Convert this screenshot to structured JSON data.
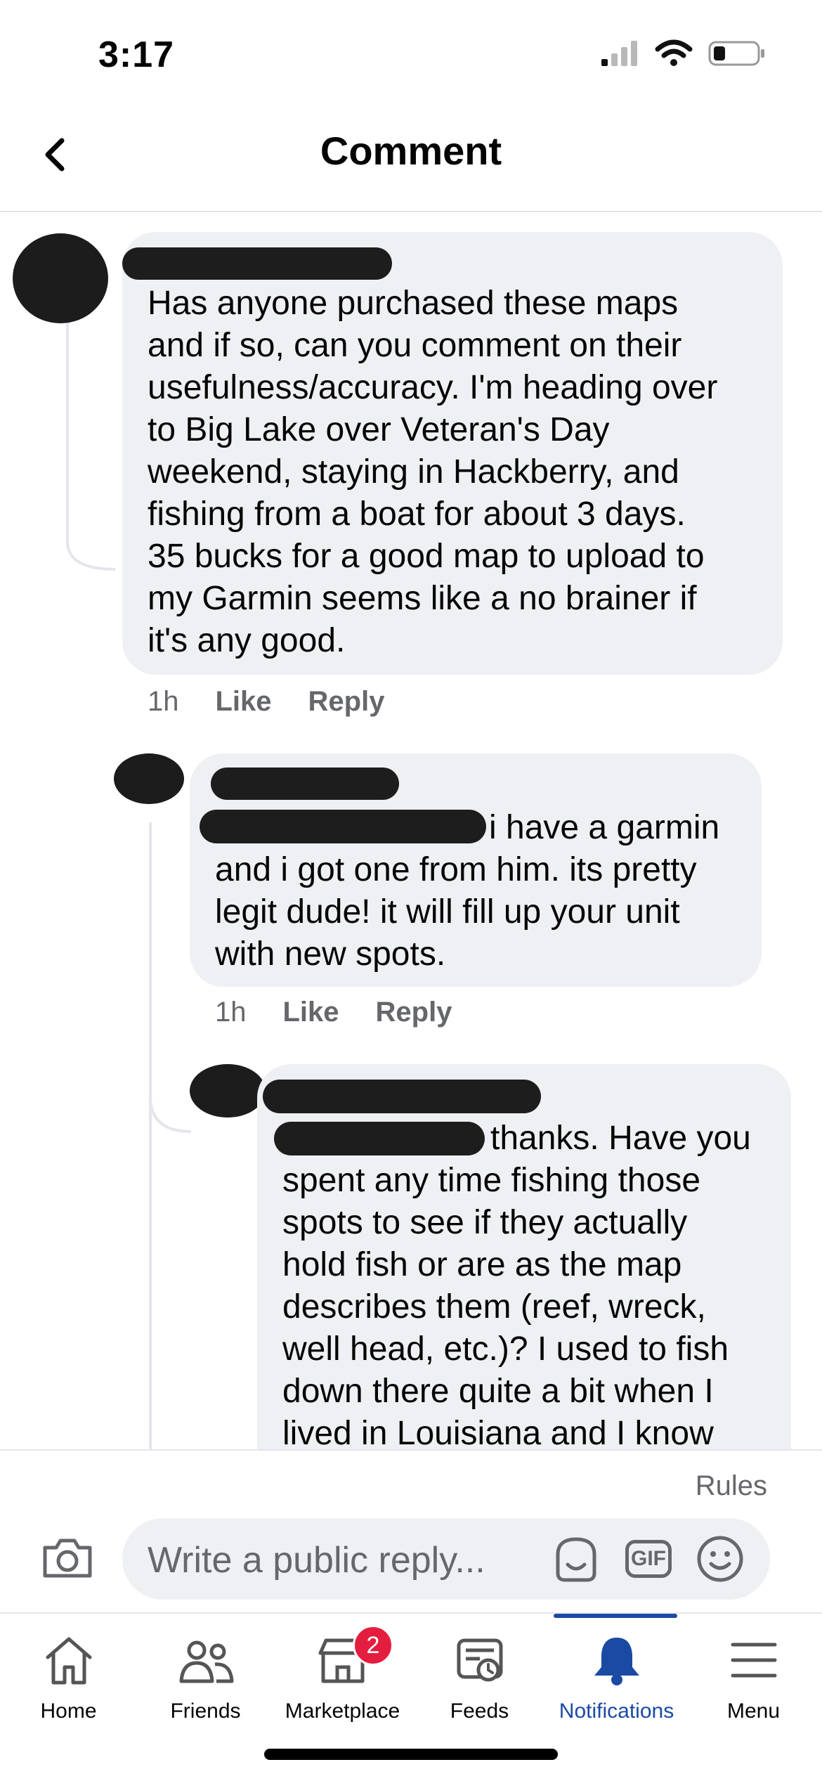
{
  "status_bar": {
    "time": "3:17"
  },
  "header": {
    "title": "Comment"
  },
  "comments": [
    {
      "lines": [
        "Has anyone purchased these maps",
        "and if so, can you comment on their",
        "usefulness/accuracy. I'm heading over",
        "to Big Lake over Veteran's Day",
        "weekend, staying in Hackberry, and",
        "fishing from a boat for about 3 days.",
        "35 bucks for a good map to upload to",
        "my Garmin seems like a no brainer if",
        "it's any good."
      ],
      "time": "1h",
      "like": "Like",
      "reply": "Reply"
    },
    {
      "lines": [
        "i have a garmin",
        "and i got one from him. its pretty",
        "legit dude!  it will fill up your unit",
        "with new spots."
      ],
      "time": "1h",
      "like": "Like",
      "reply": "Reply"
    },
    {
      "lines": [
        "thanks. Have you",
        "spent any time fishing those",
        "spots to see if they actually",
        "hold fish or are as the map",
        "describes them (reef, wreck,",
        "well head, etc.)? I used to fish",
        "down there quite a bit when I",
        "lived in Louisiana and I know"
      ]
    }
  ],
  "composer": {
    "rules": "Rules",
    "placeholder": "Write a public reply...",
    "gif": "GIF"
  },
  "tabs": [
    {
      "label": "Home",
      "icon": "home-icon"
    },
    {
      "label": "Friends",
      "icon": "friends-icon"
    },
    {
      "label": "Marketplace",
      "icon": "marketplace-icon",
      "badge": "2"
    },
    {
      "label": "Feeds",
      "icon": "feeds-icon"
    },
    {
      "label": "Notifications",
      "icon": "bell-icon",
      "active": true
    },
    {
      "label": "Menu",
      "icon": "menu-icon"
    }
  ],
  "colors": {
    "accent": "#1b4aa3",
    "bubble": "#eff0f3",
    "badge": "#e41e3f"
  }
}
